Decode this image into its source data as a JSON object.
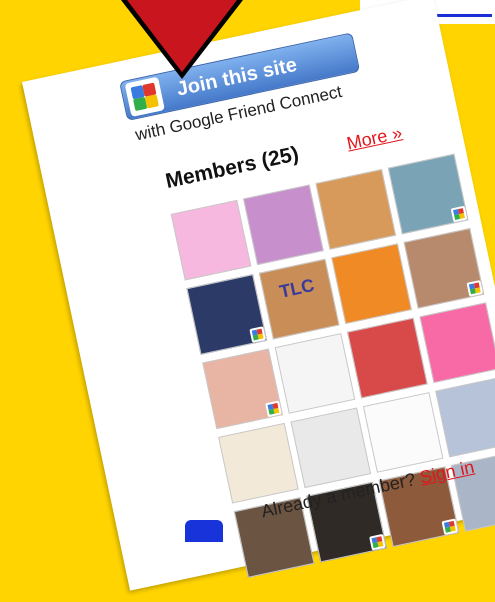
{
  "join_button": {
    "label": "Join this site"
  },
  "gfc": {
    "text": "with Google Friend Connect"
  },
  "members": {
    "title": "Members (25)",
    "more_label": "More »",
    "thumbs": [
      {
        "name": "member-thumb-1",
        "bg": "#f6b8de",
        "badge": false
      },
      {
        "name": "member-thumb-2",
        "bg": "#c78fcb",
        "badge": false
      },
      {
        "name": "member-thumb-3",
        "bg": "#d89a5a",
        "badge": false
      },
      {
        "name": "member-thumb-4",
        "bg": "#7aa4b5",
        "badge": true
      },
      {
        "name": "member-thumb-5",
        "bg": "#2b3a67",
        "badge": true
      },
      {
        "name": "member-thumb-6",
        "bg": "#c98d58",
        "badge": false
      },
      {
        "name": "member-thumb-7",
        "bg": "#f08a24",
        "badge": false
      },
      {
        "name": "member-thumb-8",
        "bg": "#b78a6e",
        "badge": true
      },
      {
        "name": "member-thumb-9",
        "bg": "#e8b5a4",
        "badge": true
      },
      {
        "name": "member-thumb-10",
        "bg": "#f5f5f5",
        "badge": false
      },
      {
        "name": "member-thumb-11",
        "bg": "#d84a4a",
        "badge": false
      },
      {
        "name": "member-thumb-12",
        "bg": "#f76aa6",
        "badge": false
      },
      {
        "name": "member-thumb-13",
        "bg": "#f2e9d8",
        "badge": false
      },
      {
        "name": "member-thumb-14",
        "bg": "#e9e9e9",
        "badge": false
      },
      {
        "name": "member-thumb-15",
        "bg": "#fbfbfb",
        "badge": false
      },
      {
        "name": "member-thumb-16",
        "bg": "#b7c3d8",
        "badge": false
      },
      {
        "name": "member-thumb-17",
        "bg": "#6b5442",
        "badge": false
      },
      {
        "name": "member-thumb-18",
        "bg": "#2f2a26",
        "badge": true
      },
      {
        "name": "member-thumb-19",
        "bg": "#8d5a3c",
        "badge": true
      },
      {
        "name": "member-thumb-20",
        "bg": "#aab6c8",
        "badge": false
      }
    ],
    "tlc_label": "TLC"
  },
  "signin": {
    "prompt": "Already a member?",
    "link": "Sign in"
  },
  "colors": {
    "accent": "#e1151b",
    "button": "#4579c9",
    "page_bg": "#ffd400",
    "blue_text": "#1733d9"
  }
}
